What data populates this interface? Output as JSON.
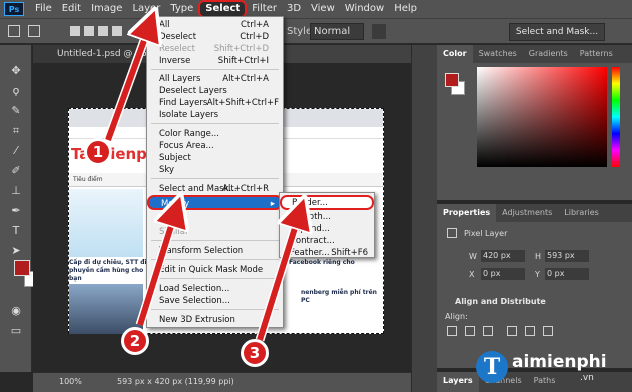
{
  "menubar": {
    "logo": "Ps",
    "items": [
      "File",
      "Edit",
      "Image",
      "Layer",
      "Type",
      "Select",
      "Filter",
      "3D",
      "View",
      "Window",
      "Help"
    ],
    "active_item": "Select"
  },
  "options_bar": {
    "style_label": "Style:",
    "style_value": "Normal",
    "select_and_mask": "Select and Mask..."
  },
  "document": {
    "tab_title": "Untitled-1.psd @ 66.7% (Layer 1, RGB/8#)",
    "site_name": "Taimienphi",
    "site_suffix": ".vn",
    "nav_tag": "Tiêu điểm",
    "article_1": "Cấp đi dự chiêu, STT đi phuyền cầm hùng cho bạn",
    "article_2": "nenberg miễn phí trên PC",
    "article_3": "Facebook riêng cho"
  },
  "status_bar": {
    "zoom": "100%",
    "size": "593 px x 420 px (119,99 ppi)"
  },
  "select_menu": {
    "items": [
      {
        "label": "All",
        "shortcut": "Ctrl+A",
        "disabled": false
      },
      {
        "label": "Deselect",
        "shortcut": "Ctrl+D",
        "disabled": false
      },
      {
        "label": "Reselect",
        "shortcut": "Shift+Ctrl+D",
        "disabled": true
      },
      {
        "label": "Inverse",
        "shortcut": "Shift+Ctrl+I",
        "disabled": false
      },
      {
        "label": "All Layers",
        "shortcut": "Alt+Ctrl+A",
        "disabled": false
      },
      {
        "label": "Deselect Layers",
        "shortcut": "",
        "disabled": false
      },
      {
        "label": "Find Layers",
        "shortcut": "Alt+Shift+Ctrl+F",
        "disabled": false
      },
      {
        "label": "Isolate Layers",
        "shortcut": "",
        "disabled": false
      },
      {
        "label": "Color Range...",
        "shortcut": "",
        "disabled": false
      },
      {
        "label": "Focus Area...",
        "shortcut": "",
        "disabled": false
      },
      {
        "label": "Subject",
        "shortcut": "",
        "disabled": false
      },
      {
        "label": "Sky",
        "shortcut": "",
        "disabled": false
      },
      {
        "label": "Select and Mask...",
        "shortcut": "Alt+Ctrl+R",
        "disabled": false
      },
      {
        "label": "Modify",
        "shortcut": "",
        "disabled": false
      },
      {
        "label": "Grow",
        "shortcut": "",
        "disabled": true
      },
      {
        "label": "Similar",
        "shortcut": "",
        "disabled": true
      },
      {
        "label": "Transform Selection",
        "shortcut": "",
        "disabled": false
      },
      {
        "label": "Edit in Quick Mask Mode",
        "shortcut": "",
        "disabled": false
      },
      {
        "label": "Load Selection...",
        "shortcut": "",
        "disabled": false
      },
      {
        "label": "Save Selection...",
        "shortcut": "",
        "disabled": false
      },
      {
        "label": "New 3D Extrusion",
        "shortcut": "",
        "disabled": false
      }
    ]
  },
  "modify_submenu": {
    "items": [
      {
        "label": "Border...",
        "shortcut": ""
      },
      {
        "label": "Smooth...",
        "shortcut": ""
      },
      {
        "label": "Expand...",
        "shortcut": ""
      },
      {
        "label": "Contract...",
        "shortcut": ""
      },
      {
        "label": "Feather...",
        "shortcut": "Shift+F6"
      }
    ]
  },
  "color_panel": {
    "tabs": [
      "Color",
      "Swatches",
      "Gradients",
      "Patterns"
    ],
    "foreground_color": "#b11c1c",
    "background_color": "#ffffff"
  },
  "properties_panel": {
    "tabs": [
      "Properties",
      "Adjustments",
      "Libraries"
    ],
    "layer_type": "Pixel Layer",
    "w_label": "W",
    "w_value": "420 px",
    "h_label": "H",
    "h_value": "593 px",
    "x_label": "X",
    "x_value": "0 px",
    "y_label": "Y",
    "y_value": "0 px",
    "align_section": "Align and Distribute",
    "align_label": "Align:"
  },
  "layers_panel": {
    "tabs": [
      "Layers",
      "Channels",
      "Paths"
    ]
  },
  "callouts": [
    "1",
    "2",
    "3"
  ],
  "watermark": {
    "letter": "T",
    "name": "aimienphi",
    "suffix": ".vn"
  }
}
